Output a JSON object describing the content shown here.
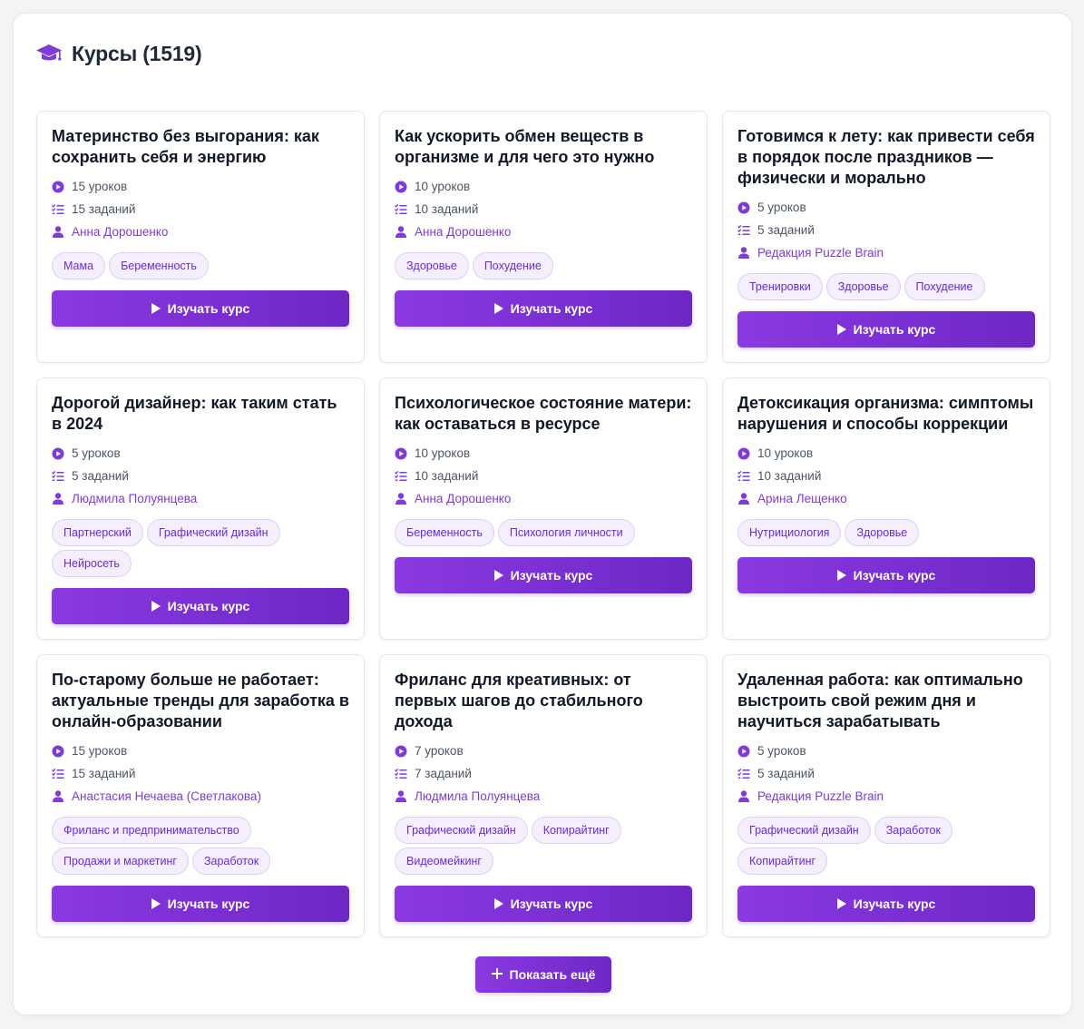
{
  "header": {
    "title": "Курсы (1519)",
    "icon": "graduation-cap-icon",
    "accent": "#7e3bd6"
  },
  "courses": [
    {
      "title": "Материнство без выгорания: как сохранить себя и энергию",
      "lessons": "15 уроков",
      "tasks": "15 заданий",
      "author": "Анна Дорошенко",
      "tags": [
        "Мама",
        "Беременность"
      ],
      "button": "Изучать курс"
    },
    {
      "title": "Как ускорить обмен веществ в организме и для чего это нужно",
      "lessons": "10 уроков",
      "tasks": "10 заданий",
      "author": "Анна Дорошенко",
      "tags": [
        "Здоровье",
        "Похудение"
      ],
      "button": "Изучать курс"
    },
    {
      "title": "Готовимся к лету: как привести себя в порядок после праздников — физически и морально",
      "lessons": "5 уроков",
      "tasks": "5 заданий",
      "author": "Редакция Puzzle Brain",
      "tags": [
        "Тренировки",
        "Здоровье",
        "Похудение"
      ],
      "button": "Изучать курс"
    },
    {
      "title": "Дорогой дизайнер: как таким стать в 2024",
      "lessons": "5 уроков",
      "tasks": "5 заданий",
      "author": "Людмила Полуянцева",
      "tags": [
        "Партнерский",
        "Графический дизайн",
        "Нейросеть"
      ],
      "button": "Изучать курс"
    },
    {
      "title": "Психологическое состояние матери: как оставаться в ресурсе",
      "lessons": "10 уроков",
      "tasks": "10 заданий",
      "author": "Анна Дорошенко",
      "tags": [
        "Беременность",
        "Психология личности"
      ],
      "button": "Изучать курс"
    },
    {
      "title": "Детоксикация организма: симптомы нарушения и способы коррекции",
      "lessons": "10 уроков",
      "tasks": "10 заданий",
      "author": "Арина Лещенко",
      "tags": [
        "Нутрициология",
        "Здоровье"
      ],
      "button": "Изучать курс"
    },
    {
      "title": "По-старому больше не работает: актуальные тренды для заработка в онлайн-образовании",
      "lessons": "15 уроков",
      "tasks": "15 заданий",
      "author": "Анастасия Нечаева (Светлакова)",
      "tags": [
        "Фриланс и предпринимательство",
        "Продажи и маркетинг",
        "Заработок"
      ],
      "button": "Изучать курс"
    },
    {
      "title": "Фриланс для креативных: от первых шагов до стабильного дохода",
      "lessons": "7 уроков",
      "tasks": "7 заданий",
      "author": "Людмила Полуянцева",
      "tags": [
        "Графический дизайн",
        "Копирайтинг",
        "Видеомейкинг"
      ],
      "button": "Изучать курс"
    },
    {
      "title": "Удаленная работа: как оптимально выстроить свой режим дня и научиться зарабатывать",
      "lessons": "5 уроков",
      "tasks": "5 заданий",
      "author": "Редакция Puzzle Brain",
      "tags": [
        "Графический дизайн",
        "Заработок",
        "Копирайтинг"
      ],
      "button": "Изучать курс"
    }
  ],
  "load_more": {
    "label": "Показать ещё",
    "icon": "plus-icon"
  }
}
